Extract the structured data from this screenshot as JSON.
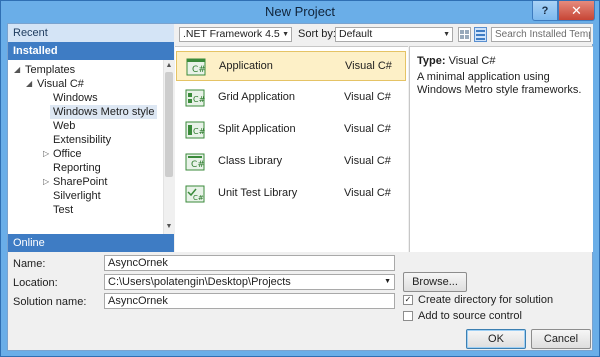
{
  "window": {
    "title": "New Project",
    "help": "?",
    "close": "✕"
  },
  "left": {
    "recent": "Recent",
    "installed": "Installed",
    "online": "Online",
    "tree": {
      "templates": "Templates",
      "visual_csharp": "Visual C#",
      "windows": "Windows",
      "metro": "Windows Metro style",
      "web": "Web",
      "extensibility": "Extensibility",
      "office": "Office",
      "reporting": "Reporting",
      "sharepoint": "SharePoint",
      "silverlight": "Silverlight",
      "test": "Test"
    }
  },
  "toolbar": {
    "framework": ".NET Framework 4.5",
    "sort_label": "Sort by:",
    "sort_value": "Default",
    "search_placeholder": "Search Installed Temp"
  },
  "templates": [
    {
      "name": "Application",
      "lang": "Visual C#"
    },
    {
      "name": "Grid Application",
      "lang": "Visual C#"
    },
    {
      "name": "Split Application",
      "lang": "Visual C#"
    },
    {
      "name": "Class Library",
      "lang": "Visual C#"
    },
    {
      "name": "Unit Test Library",
      "lang": "Visual C#"
    }
  ],
  "details": {
    "type_label": "Type:",
    "type_value": "Visual C#",
    "description": "A minimal application using Windows Metro style frameworks."
  },
  "form": {
    "name_label": "Name:",
    "name_value": "AsyncOrnek",
    "location_label": "Location:",
    "location_value": "C:\\Users\\polatengin\\Desktop\\Projects",
    "solution_label": "Solution name:",
    "solution_value": "AsyncOrnek",
    "browse": "Browse...",
    "create_dir": "Create directory for solution",
    "add_source": "Add to source control",
    "ok": "OK",
    "cancel": "Cancel"
  },
  "colors": {
    "accent": "#3e7cc4",
    "selected_row": "#fdf0c7",
    "title_bar": "#6aaee8",
    "close_button": "#c74535"
  }
}
